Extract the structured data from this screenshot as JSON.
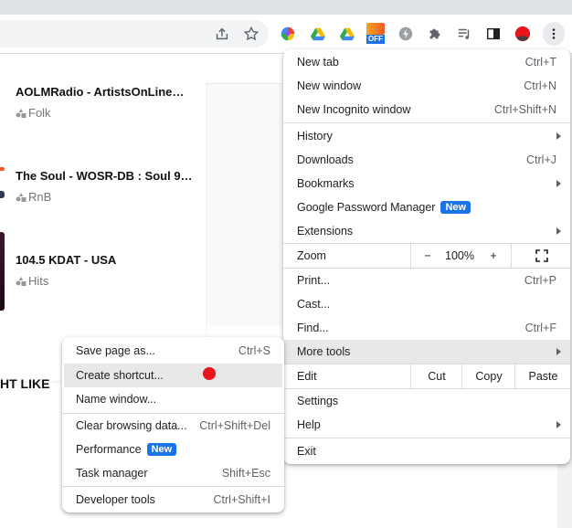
{
  "toolbar": {
    "icons": [
      "share-icon",
      "bookmark-star-icon",
      "color-wheel-extension-icon",
      "drive-extension-icon",
      "drive-extension-icon-2",
      "off-extension-icon",
      "speed-extension-icon",
      "extensions-puzzle-icon",
      "media-playlist-icon",
      "side-panel-icon",
      "profile-avatar-icon",
      "more-menu-icon"
    ],
    "off_badge": "OFF"
  },
  "stations": [
    {
      "name": "AOLMRadio - ArtistsOnLine…",
      "genre": "Folk"
    },
    {
      "name": "The Soul - WOSR-DB : Soul 9…",
      "genre": "RnB"
    },
    {
      "name": "104.5 KDAT - USA",
      "genre": "Hits"
    }
  ],
  "page_heading": "HT LIKE",
  "main_menu": {
    "new_tab": {
      "label": "New tab",
      "shortcut": "Ctrl+T"
    },
    "new_window": {
      "label": "New window",
      "shortcut": "Ctrl+N"
    },
    "new_incognito": {
      "label": "New Incognito window",
      "shortcut": "Ctrl+Shift+N"
    },
    "history": {
      "label": "History"
    },
    "downloads": {
      "label": "Downloads",
      "shortcut": "Ctrl+J"
    },
    "bookmarks": {
      "label": "Bookmarks"
    },
    "password_manager": {
      "label": "Google Password Manager",
      "badge": "New"
    },
    "extensions": {
      "label": "Extensions"
    },
    "zoom": {
      "label": "Zoom",
      "minus": "−",
      "value": "100%",
      "plus": "+"
    },
    "print": {
      "label": "Print...",
      "shortcut": "Ctrl+P"
    },
    "cast": {
      "label": "Cast..."
    },
    "find": {
      "label": "Find...",
      "shortcut": "Ctrl+F"
    },
    "more_tools": {
      "label": "More tools"
    },
    "edit": {
      "label": "Edit",
      "cut": "Cut",
      "copy": "Copy",
      "paste": "Paste"
    },
    "settings": {
      "label": "Settings"
    },
    "help": {
      "label": "Help"
    },
    "exit": {
      "label": "Exit"
    }
  },
  "sub_menu": {
    "save_page": {
      "label": "Save page as...",
      "shortcut": "Ctrl+S"
    },
    "create_shortcut": {
      "label": "Create shortcut..."
    },
    "name_window": {
      "label": "Name window..."
    },
    "clear_data": {
      "label": "Clear browsing data...",
      "shortcut": "Ctrl+Shift+Del"
    },
    "performance": {
      "label": "Performance",
      "badge": "New"
    },
    "task_manager": {
      "label": "Task manager",
      "shortcut": "Shift+Esc"
    },
    "dev_tools": {
      "label": "Developer tools",
      "shortcut": "Ctrl+Shift+I"
    }
  },
  "colors": {
    "accent": "#1a73e8",
    "pointer_dot": "#e8141c",
    "highlight": "#e8e8e9"
  }
}
